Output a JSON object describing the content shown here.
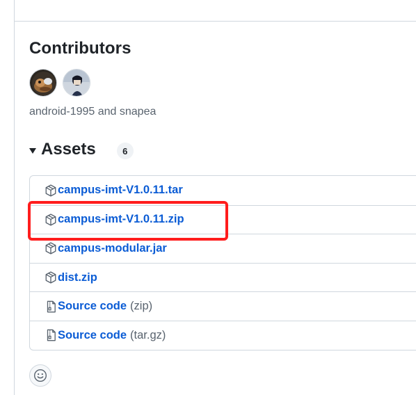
{
  "contributors": {
    "title": "Contributors",
    "avatars": [
      "android-1995",
      "snapea"
    ],
    "names_text": "android-1995 and snapea"
  },
  "assets": {
    "title": "Assets",
    "count": "6",
    "items": [
      {
        "name": "campus-imt-V1.0.11.tar",
        "suffix": "",
        "icon": "package-icon"
      },
      {
        "name": "campus-imt-V1.0.11.zip",
        "suffix": "",
        "icon": "package-icon"
      },
      {
        "name": "campus-modular.jar",
        "suffix": "",
        "icon": "package-icon"
      },
      {
        "name": "dist.zip",
        "suffix": "",
        "icon": "package-icon"
      },
      {
        "name": "Source code",
        "suffix": "(zip)",
        "icon": "file-zip-icon"
      },
      {
        "name": "Source code",
        "suffix": "(tar.gz)",
        "icon": "file-zip-icon"
      }
    ]
  },
  "annotation": {
    "highlight_color": "#ff1d1d"
  },
  "colors": {
    "link": "#0b5cd5",
    "muted": "#59636e",
    "border": "#d0d7de"
  }
}
